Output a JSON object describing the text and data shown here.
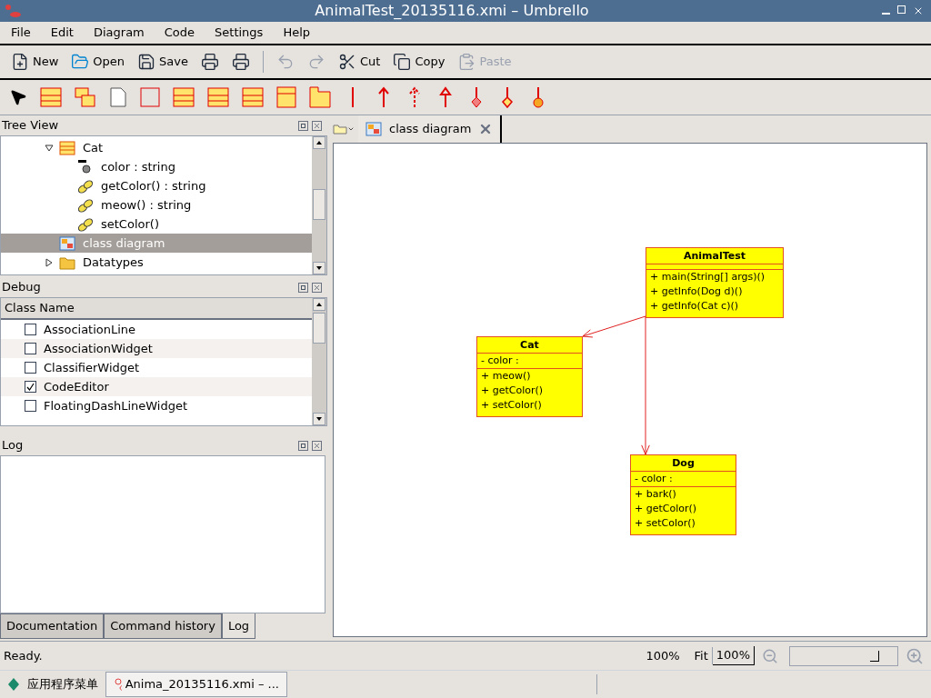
{
  "window": {
    "title": "AnimalTest_20135116.xmi – Umbrello"
  },
  "menu": [
    "File",
    "Edit",
    "Diagram",
    "Code",
    "Settings",
    "Help"
  ],
  "toolbar": [
    {
      "kind": "new",
      "label": "New",
      "disabled": false
    },
    {
      "kind": "open",
      "label": "Open",
      "disabled": false
    },
    {
      "kind": "save",
      "label": "Save",
      "disabled": false
    },
    {
      "kind": "print",
      "disabled": false
    },
    {
      "kind": "preview",
      "disabled": false
    },
    {
      "kind": "separator"
    },
    {
      "kind": "undo",
      "disabled": true
    },
    {
      "kind": "redo",
      "disabled": true
    },
    {
      "kind": "cut",
      "label": "Cut",
      "disabled": false
    },
    {
      "kind": "copy",
      "label": "Copy",
      "disabled": false
    },
    {
      "kind": "paste",
      "label": "Paste",
      "disabled": true
    }
  ],
  "palette": [
    {
      "kind": "pointer",
      "selected": false
    },
    {
      "kind": "class",
      "selected": false
    },
    {
      "kind": "template",
      "selected": false
    },
    {
      "kind": "note",
      "selected": false
    },
    {
      "kind": "box",
      "selected": false
    },
    {
      "kind": "class",
      "selected": false
    },
    {
      "kind": "class",
      "selected": false
    },
    {
      "kind": "class",
      "selected": false
    },
    {
      "kind": "enum",
      "selected": false
    },
    {
      "kind": "package",
      "selected": false
    },
    {
      "kind": "line",
      "selected": false
    },
    {
      "kind": "arrow",
      "selected": false
    },
    {
      "kind": "dashed-arrow",
      "selected": false
    },
    {
      "kind": "open-arrow",
      "selected": false
    },
    {
      "kind": "diamond-filled",
      "selected": false
    },
    {
      "kind": "diamond",
      "selected": false
    },
    {
      "kind": "circle",
      "selected": false
    }
  ],
  "tree_view": {
    "title": "Tree View",
    "items": [
      {
        "kind": "class",
        "label": "Cat",
        "expanded": true,
        "selected": false,
        "children": [
          {
            "kind": "attribute",
            "label": "color : string",
            "selected": false
          },
          {
            "kind": "operation",
            "label": "getColor() : string",
            "selected": false
          },
          {
            "kind": "operation",
            "label": "meow() : string",
            "selected": false
          },
          {
            "kind": "operation",
            "label": "setColor()",
            "selected": false
          }
        ]
      },
      {
        "kind": "diagram",
        "label": "class diagram",
        "selected": true
      },
      {
        "kind": "folder",
        "label": "Datatypes",
        "expanded": false,
        "selected": false
      }
    ]
  },
  "debug": {
    "title": "Debug",
    "column": "Class Name",
    "rows": [
      {
        "name": "AssociationLine",
        "checked": false
      },
      {
        "name": "AssociationWidget",
        "checked": false
      },
      {
        "name": "ClassifierWidget",
        "checked": false
      },
      {
        "name": "CodeEditor",
        "checked": true
      },
      {
        "name": "FloatingDashLineWidget",
        "checked": false
      }
    ]
  },
  "log": {
    "title": "Log"
  },
  "bottom_tabs": [
    {
      "label": "Documentation",
      "selected": false
    },
    {
      "label": "Command history",
      "selected": false
    },
    {
      "label": "Log",
      "selected": true
    }
  ],
  "diagram_tabs": [
    {
      "label": "class diagram",
      "selected": true
    }
  ],
  "diagram": {
    "classes": [
      {
        "name": "AnimalTest",
        "operations": [
          "+ main(String[] args)()",
          "+ getInfo(Dog d)()",
          "+ getInfo(Cat c)()"
        ]
      },
      {
        "name": "Cat",
        "attributes": [
          "- color :"
        ],
        "operations": [
          "+ meow()",
          "+ getColor()",
          "+ setColor()"
        ]
      },
      {
        "name": "Dog",
        "attributes": [
          "- color :"
        ],
        "operations": [
          "+ bark()",
          "+ getColor()",
          "+ setColor()"
        ]
      }
    ],
    "associations": [
      {
        "kind": "directed"
      },
      {
        "kind": "directed"
      }
    ]
  },
  "status_bar": {
    "text": "Ready.",
    "zoom": "100%",
    "fit": "Fit",
    "zoom_button": "100%",
    "zoom_slider": {
      "level": 0.8
    }
  },
  "taskbar": {
    "menu": "应用程序菜单",
    "windows": [
      {
        "label": "Anima_20135116.xmi – ...",
        "selected": true
      }
    ]
  }
}
